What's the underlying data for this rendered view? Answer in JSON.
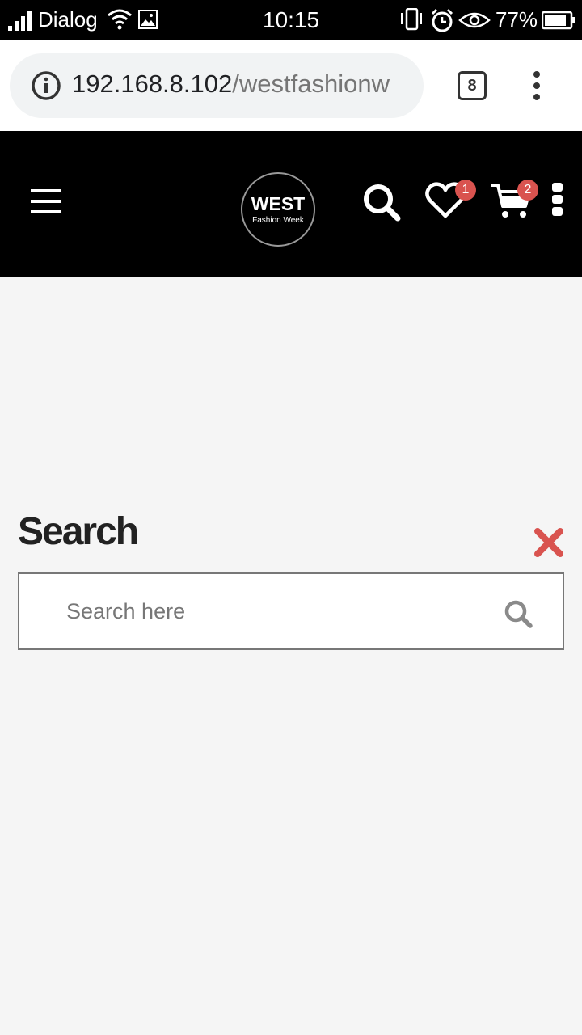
{
  "status_bar": {
    "carrier": "Dialog",
    "time": "10:15",
    "battery": "77%"
  },
  "browser": {
    "url_host": "192.168.8.102",
    "url_path": "/westfashionw",
    "tab_count": "8"
  },
  "header": {
    "logo_title": "WEST",
    "logo_subtitle": "Fashion Week",
    "wishlist_count": "1",
    "cart_count": "2"
  },
  "search_panel": {
    "title": "Search",
    "placeholder": "Search here"
  },
  "colors": {
    "header_bg": "#000000",
    "badge": "#d9534f",
    "close": "#d9534f",
    "page_bg": "#f5f5f5"
  },
  "icons": [
    "signal-icon",
    "wifi-icon",
    "image-icon",
    "vibrate-icon",
    "alarm-icon",
    "eye-icon",
    "battery-icon",
    "info-icon",
    "menu-dots-icon",
    "hamburger-icon",
    "search-icon",
    "heart-icon",
    "cart-icon",
    "more-icon",
    "close-icon"
  ]
}
